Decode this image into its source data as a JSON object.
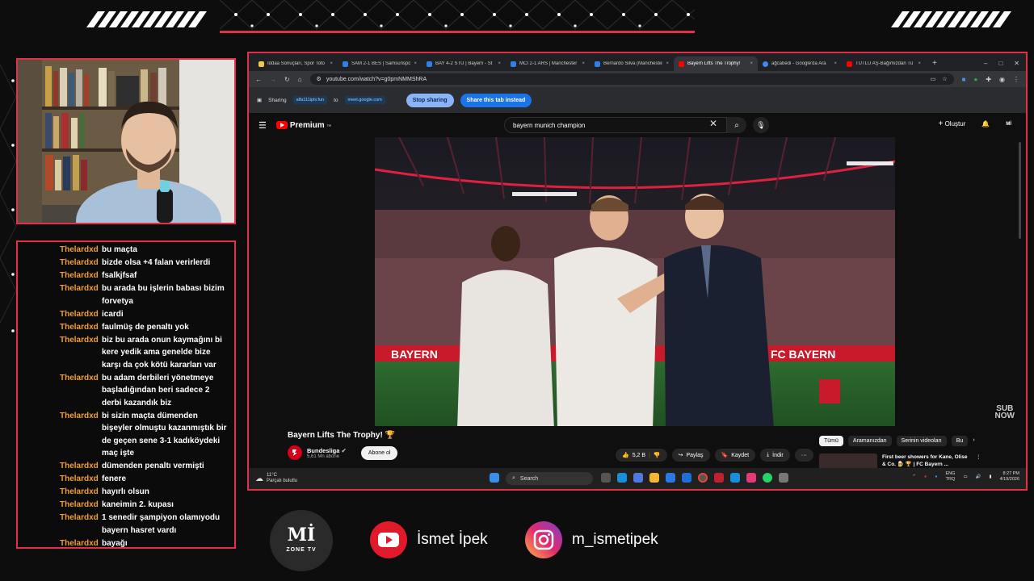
{
  "browser": {
    "tabs": [
      {
        "title": "İddaa Sonuçları, Spor Toto",
        "color": "#f2c94c",
        "active": false
      },
      {
        "title": "SAM 2-1 BES | Samsunspor",
        "color": "#2f80ed",
        "active": false
      },
      {
        "title": "BAY 4-2 STU | Bayern - St",
        "color": "#2f80ed",
        "active": false
      },
      {
        "title": "MCI 2-1 ARS | Manchester",
        "color": "#2f80ed",
        "active": false
      },
      {
        "title": "Bernardo Silva (Manchester",
        "color": "#2f80ed",
        "active": false
      },
      {
        "title": "Bayern Lifts The Trophy!",
        "color": "#ff0000",
        "active": true
      },
      {
        "title": "ağcabedi - Google'da Ara",
        "color": "#4285f4",
        "active": false
      },
      {
        "title": "TUTLU AŞ-Bağımızdan Tü",
        "color": "#ff0000",
        "active": false
      }
    ],
    "url": "youtube.com/watch?v=g0pmNMMShRA",
    "sharing": {
      "label": "Sharing",
      "from": "alfa111iptv.fun",
      "to_word": "to",
      "to": "meet.google.com",
      "stop_label": "Stop sharing",
      "share_tab_label": "Share this tab instead"
    }
  },
  "youtube": {
    "logo_text": "Premium",
    "logo_suffix": "TR",
    "search_query": "bayern munich champion",
    "create_label": "Oluştur",
    "video_title": "Bayern Lifts The Trophy! 🏆",
    "channel_name": "Bundesliga",
    "channel_subs": "5,61 Mn abone",
    "subscribe_label": "Abone ol",
    "likes": "5,2 B",
    "share_label": "Paylaş",
    "save_label": "Kaydet",
    "download_label": "İndir",
    "filter_chips": [
      "Tümü",
      "Aramanızdan",
      "Serinin videoları",
      "Bu"
    ],
    "rec_title": "First beer showers for Kane, Olise & Co. 🍺 🏆 | FC Bayern ...",
    "watermark": [
      "SUB",
      "NOW"
    ]
  },
  "taskbar": {
    "temp": "11°C",
    "weather": "Parçalı bulutlu",
    "search_placeholder": "Search",
    "lang": [
      "ENG",
      "TRQ"
    ],
    "time": "8:27 PM",
    "date": "4/19/2026"
  },
  "chat": [
    {
      "user": "Thelardxd",
      "text": "bu maçta"
    },
    {
      "user": "Thelardxd",
      "text": "bizde olsa +4 falan verirlerdi"
    },
    {
      "user": "Thelardxd",
      "text": "fsalkjfsaf"
    },
    {
      "user": "Thelardxd",
      "text": "bu arada bu işlerin babası bizim forvetya"
    },
    {
      "user": "Thelardxd",
      "text": "icardi"
    },
    {
      "user": "Thelardxd",
      "text": "faulmüş de penaltı yok"
    },
    {
      "user": "Thelardxd",
      "text": "biz bu arada onun kaymağını bi kere yedik ama genelde bize karşı da çok kötü kararları var"
    },
    {
      "user": "Thelardxd",
      "text": "bu adam derbileri yönetmeye başladığından beri sadece 2 derbi kazandık biz"
    },
    {
      "user": "Thelardxd",
      "text": "bi sizin maçta dümenden bişeyler olmuştu kazanmıştık bir de geçen sene 3-1 kadıköydeki maç işte"
    },
    {
      "user": "Thelardxd",
      "text": "dümenden penaltı vermişti"
    },
    {
      "user": "Thelardxd",
      "text": "fenere"
    },
    {
      "user": "Thelardxd",
      "text": "hayırlı olsun"
    },
    {
      "user": "Thelardxd",
      "text": "kaneimin 2. kupası"
    },
    {
      "user": "Thelardxd",
      "text": "1 senedir şampiyon olamıyodu bayern hasret vardı"
    },
    {
      "user": "Thelardxd",
      "text": "bayağı"
    }
  ],
  "footer": {
    "brand_logo": "Mİ",
    "brand_sub": "ZONE TV",
    "youtube_name": "İsmet İpek",
    "instagram_handle": "m_ismetipek"
  },
  "colors": {
    "accent": "#e0304a",
    "chat_user": "#f0a030",
    "youtube_red": "#ff0000"
  }
}
